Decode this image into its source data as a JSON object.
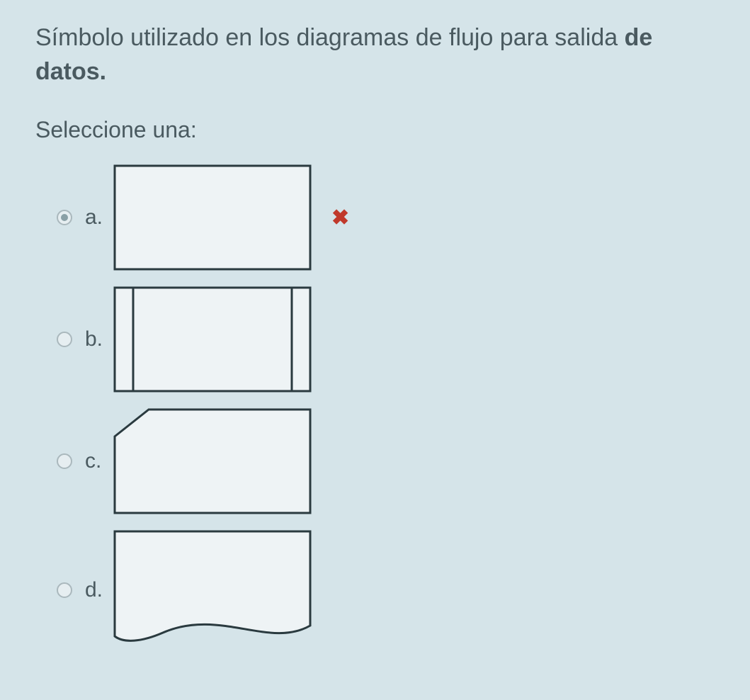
{
  "question": {
    "prefix": "Símbolo utilizado en los diagramas de flujo para salida ",
    "bold": "de datos."
  },
  "instruction": "Seleccione una:",
  "options": {
    "a": {
      "label": "a.",
      "selected": true,
      "feedback": "incorrect"
    },
    "b": {
      "label": "b.",
      "selected": false
    },
    "c": {
      "label": "c.",
      "selected": false
    },
    "d": {
      "label": "d.",
      "selected": false
    }
  },
  "icons": {
    "incorrect_glyph": "✖"
  }
}
